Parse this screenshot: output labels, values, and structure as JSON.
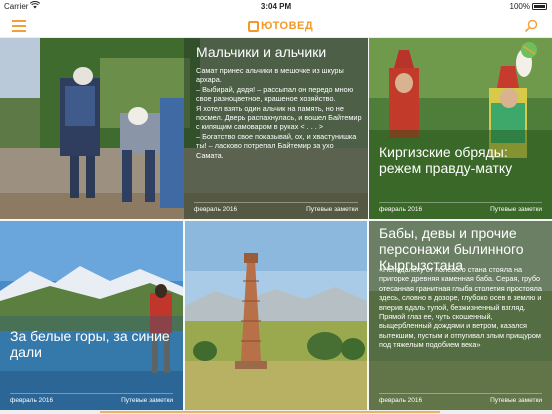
{
  "statusbar": {
    "carrier": "Carrier",
    "time": "3:04 PM",
    "battery": "100%"
  },
  "navbar": {
    "logo": "ЮТОВЕД"
  },
  "cards": [
    {
      "title": "Мальчики и альчики",
      "excerpt": "Самат принес альчики в мешочке из шкуры архара.\n– Выбирай, дядя! – рассыпал он передо мною свое разноцветное, крашеное хозяйство.\nЯ хотел взять один альчик на память, но не посмел. Дверь распахнулась, и вошел Байтемир с кипящим самоваром в руках < . . . >\n– Богатство свое показывай, ох, и хвастунишка ты! – ласково потрепал Байтемир за ухо Самата.",
      "date": "февраль 2016",
      "category": "Путевые заметки"
    },
    {
      "title": "Киргизские обряды: режем правду-матку",
      "date": "февраль 2016",
      "category": "Путевые заметки"
    },
    {
      "title": "За белые горы, за синие дали",
      "date": "февраль 2016",
      "category": "Путевые заметки"
    },
    {
      "title": "",
      "date": "",
      "category": ""
    },
    {
      "title": "Бабы, девы и прочие персонажи былинного Кыргызстана",
      "excerpt": "«Неподалеку от полевого стана стояла на пригорке древняя каменная баба. Серая, грубо отесанная гранитная глыба столетия простояла здесь, словно в дозоре, глубоко осев в землю и вперив вдаль тупой, безжизненный взгляд. Прямой глаз ее, чуть скошенный, выщербленный дождями и ветром, казался вытекшим, пустым и отпугивал злым прищуром под тяжелым подобием века»",
      "date": "февраль 2016",
      "category": "Путевые заметки"
    }
  ],
  "icons": {
    "menu": "hamburger-menu-icon",
    "search": "search-icon",
    "logo": "logo-icon"
  },
  "colors": {
    "accent": "#f09a2a"
  }
}
